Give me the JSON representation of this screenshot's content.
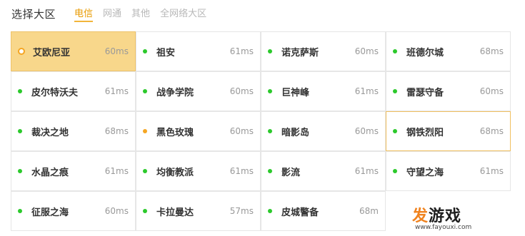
{
  "header": {
    "title": "选择大区",
    "tabs": [
      {
        "label": "电信",
        "active": true
      },
      {
        "label": "网通",
        "active": false
      },
      {
        "label": "其他",
        "active": false
      },
      {
        "label": "全网络大区",
        "active": false
      }
    ]
  },
  "servers": [
    {
      "name": "艾欧尼亚",
      "ping": "60ms",
      "status": "selected"
    },
    {
      "name": "祖安",
      "ping": "61ms",
      "status": "green"
    },
    {
      "name": "诺克萨斯",
      "ping": "60ms",
      "status": "green"
    },
    {
      "name": "班德尔城",
      "ping": "68ms",
      "status": "green"
    },
    {
      "name": "皮尔特沃夫",
      "ping": "61ms",
      "status": "green"
    },
    {
      "name": "战争学院",
      "ping": "60ms",
      "status": "green"
    },
    {
      "name": "巨神峰",
      "ping": "61ms",
      "status": "green"
    },
    {
      "name": "雷瑟守备",
      "ping": "60ms",
      "status": "green"
    },
    {
      "name": "裁决之地",
      "ping": "68ms",
      "status": "green"
    },
    {
      "name": "黑色玫瑰",
      "ping": "60ms",
      "status": "orange"
    },
    {
      "name": "暗影岛",
      "ping": "60ms",
      "status": "green"
    },
    {
      "name": "钢铁烈阳",
      "ping": "68ms",
      "status": "hover"
    },
    {
      "name": "水晶之痕",
      "ping": "61ms",
      "status": "green"
    },
    {
      "name": "均衡教派",
      "ping": "61ms",
      "status": "green"
    },
    {
      "name": "影流",
      "ping": "61ms",
      "status": "green"
    },
    {
      "name": "守望之海",
      "ping": "61ms",
      "status": "green"
    },
    {
      "name": "征服之海",
      "ping": "60ms",
      "status": "green"
    },
    {
      "name": "卡拉曼达",
      "ping": "57ms",
      "status": "green"
    },
    {
      "name": "皮城警备",
      "ping": "68m",
      "status": "green"
    }
  ],
  "colors": {
    "online": "#2bc92b",
    "busy": "#f5a623",
    "selected_bg": "#f8d78b",
    "accent": "#e89a00"
  },
  "watermark": {
    "brand_accent": "发",
    "brand_rest": "游戏",
    "url": "www.fayouxi.com"
  }
}
